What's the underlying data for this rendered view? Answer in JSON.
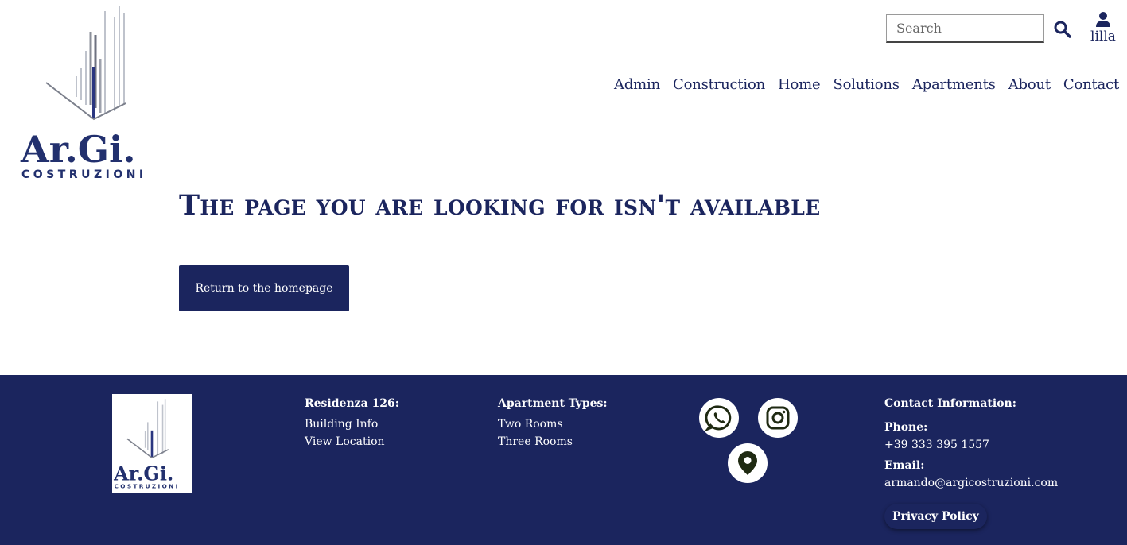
{
  "brand": {
    "logo_wordmark": "Ar.Gi.",
    "logo_subtitle": "COSTRUZIONI"
  },
  "header": {
    "search_placeholder": "Search",
    "user_label": "lilla",
    "nav": [
      "Admin",
      "Construction",
      "Home",
      "Solutions",
      "Apartments",
      "About",
      "Contact"
    ]
  },
  "main": {
    "title": "The page you are looking for isn't available",
    "home_button": "Return to the homepage"
  },
  "footer": {
    "residenza": {
      "heading": "Residenza 126:",
      "links": [
        "Building Info",
        "View Location"
      ]
    },
    "apartments": {
      "heading": "Apartment Types:",
      "links": [
        "Two Rooms",
        "Three Rooms"
      ]
    },
    "social": [
      "whatsapp-icon",
      "instagram-icon",
      "location-pin-icon"
    ],
    "contact": {
      "heading": "Contact Information:",
      "phone_label": "Phone:",
      "phone": "+39 333 395 1557",
      "email_label": "Email:",
      "email": "armando@argicostruzioni.com",
      "privacy": "Privacy Policy"
    }
  },
  "colors": {
    "brand_navy": "#1b255e",
    "white": "#ffffff",
    "icon_dark": "#1f2a12"
  }
}
